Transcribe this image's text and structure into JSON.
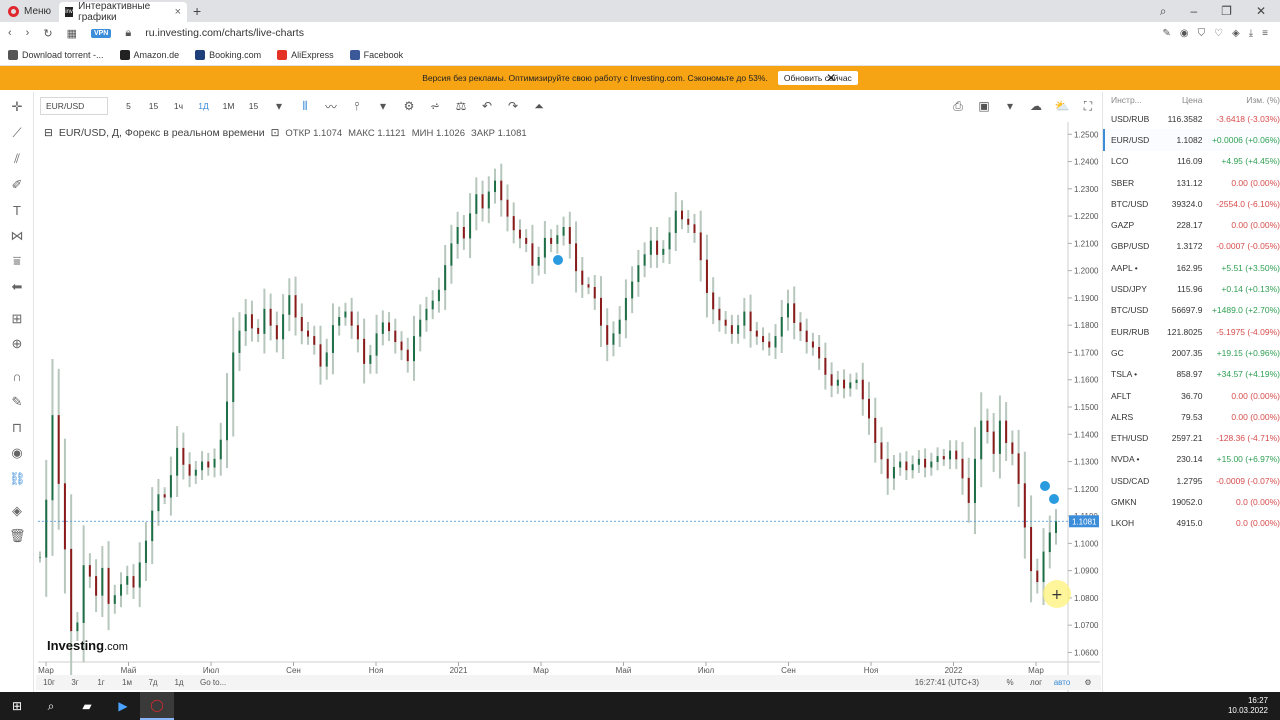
{
  "browser": {
    "menu_label": "Меню",
    "tab_title": "Интерактивные графики",
    "tab_favicon": "inv",
    "address": "ru.investing.com/charts/live-charts",
    "vpn_badge": "VPN",
    "bookmarks": [
      "Download torrent -...",
      "Amazon.de",
      "Booking.com",
      "AliExpress",
      "Facebook"
    ]
  },
  "promo": {
    "text": "Версия без рекламы. Оптимизируйте свою работу с Investing.com. Сэкономьте до 53%.",
    "button": "Обновить сейчас",
    "close": "✕"
  },
  "toolbar": {
    "symbol": "EUR/USD",
    "timeframes": [
      "5",
      "15",
      "1ч",
      "1Д",
      "1М",
      "15"
    ],
    "active_timeframe": "1Д"
  },
  "legend": {
    "title": "EUR/USD, Д, Форекс в реальном времени",
    "open": "ОТКР 1.1074",
    "high": "МАКС 1.1121",
    "low": "МИН 1.1026",
    "close": "ЗАКР 1.1081"
  },
  "logo": {
    "main": "Investing",
    "suffix": ".com"
  },
  "bottom": {
    "ranges": [
      "10г",
      "3г",
      "1г",
      "1м",
      "7д",
      "1д",
      "Go to..."
    ],
    "time": "16:27:41 (UTC+3)",
    "percent": "%",
    "log": "лог",
    "auto": "авто"
  },
  "chart_data": {
    "type": "line",
    "title": "EUR/USD, Д, Форекс в реальном времени",
    "x_tick_labels": [
      "Мар",
      "Май",
      "Июл",
      "Сен",
      "Ноя",
      "2021",
      "Мар",
      "Май",
      "Июл",
      "Сен",
      "Ноя",
      "2022",
      "Мар"
    ],
    "y_tick_labels": [
      "1.2500",
      "1.2400",
      "1.2300",
      "1.2200",
      "1.2100",
      "1.2000",
      "1.1900",
      "1.1800",
      "1.1700",
      "1.1600",
      "1.1500",
      "1.1400",
      "1.1300",
      "1.1200",
      "1.1100",
      "1.1000",
      "1.0900",
      "1.0800",
      "1.0700",
      "1.0600"
    ],
    "ylim": [
      1.0565,
      1.2545
    ],
    "last_price": "1.1081",
    "last_value": 1.1081,
    "series": [
      {
        "values": [
          1.095,
          1.116,
          1.147,
          1.122,
          1.098,
          1.068,
          1.071,
          1.092,
          1.088,
          1.081,
          1.091,
          1.078,
          1.081,
          1.085,
          1.088,
          1.084,
          1.093,
          1.101,
          1.112,
          1.118,
          1.117,
          1.125,
          1.135,
          1.129,
          1.125,
          1.127,
          1.13,
          1.128,
          1.131,
          1.138,
          1.152,
          1.17,
          1.178,
          1.184,
          1.179,
          1.177,
          1.186,
          1.18,
          1.175,
          1.184,
          1.191,
          1.183,
          1.178,
          1.176,
          1.173,
          1.165,
          1.17,
          1.18,
          1.183,
          1.185,
          1.18,
          1.175,
          1.166,
          1.169,
          1.177,
          1.181,
          1.178,
          1.174,
          1.171,
          1.167,
          1.176,
          1.182,
          1.186,
          1.189,
          1.193,
          1.202,
          1.21,
          1.216,
          1.212,
          1.221,
          1.228,
          1.223,
          1.229,
          1.233,
          1.226,
          1.22,
          1.215,
          1.212,
          1.21,
          1.202,
          1.205,
          1.212,
          1.21,
          1.213,
          1.216,
          1.21,
          1.2,
          1.195,
          1.194,
          1.19,
          1.18,
          1.173,
          1.177,
          1.182,
          1.19,
          1.196,
          1.202,
          1.206,
          1.211,
          1.206,
          1.208,
          1.214,
          1.222,
          1.219,
          1.217,
          1.214,
          1.204,
          1.192,
          1.186,
          1.182,
          1.18,
          1.177,
          1.18,
          1.185,
          1.178,
          1.176,
          1.174,
          1.172,
          1.176,
          1.183,
          1.188,
          1.181,
          1.178,
          1.174,
          1.172,
          1.168,
          1.162,
          1.158,
          1.16,
          1.157,
          1.159,
          1.16,
          1.153,
          1.146,
          1.137,
          1.131,
          1.124,
          1.128,
          1.13,
          1.127,
          1.129,
          1.131,
          1.128,
          1.13,
          1.132,
          1.131,
          1.134,
          1.131,
          1.124,
          1.115,
          1.131,
          1.145,
          1.141,
          1.133,
          1.145,
          1.137,
          1.133,
          1.122,
          1.106,
          1.09,
          1.086,
          1.097,
          1.104,
          1.1081
        ]
      }
    ]
  },
  "watchlist": {
    "headers": [
      "Инстр...",
      "Цена",
      "Изм. (%)"
    ],
    "rows": [
      {
        "name": "USD/RUB",
        "price": "116.3582",
        "change": "-3.6418 (-3.03%)",
        "dir": "dn"
      },
      {
        "name": "EUR/USD",
        "price": "1.1082",
        "change": "+0.0006 (+0.06%)",
        "dir": "up"
      },
      {
        "name": "LCO",
        "price": "116.09",
        "change": "+4.95 (+4.45%)",
        "dir": "up"
      },
      {
        "name": "SBER",
        "price": "131.12",
        "change": "0.00 (0.00%)",
        "dir": "dn"
      },
      {
        "name": "BTC/USD",
        "price": "39324.0",
        "change": "-2554.0 (-6.10%)",
        "dir": "dn"
      },
      {
        "name": "GAZP",
        "price": "228.17",
        "change": "0.00 (0.00%)",
        "dir": "dn"
      },
      {
        "name": "GBP/USD",
        "price": "1.3172",
        "change": "-0.0007 (-0.05%)",
        "dir": "dn"
      },
      {
        "name": "AAPL •",
        "price": "162.95",
        "change": "+5.51 (+3.50%)",
        "dir": "up"
      },
      {
        "name": "USD/JPY",
        "price": "115.96",
        "change": "+0.14 (+0.13%)",
        "dir": "up"
      },
      {
        "name": "BTC/USD",
        "price": "56697.9",
        "change": "+1489.0 (+2.70%)",
        "dir": "up"
      },
      {
        "name": "EUR/RUB",
        "price": "121.8025",
        "change": "-5.1975 (-4.09%)",
        "dir": "dn"
      },
      {
        "name": "GC",
        "price": "2007.35",
        "change": "+19.15 (+0.96%)",
        "dir": "up"
      },
      {
        "name": "TSLA •",
        "price": "858.97",
        "change": "+34.57 (+4.19%)",
        "dir": "up"
      },
      {
        "name": "AFLT",
        "price": "36.70",
        "change": "0.00 (0.00%)",
        "dir": "dn"
      },
      {
        "name": "ALRS",
        "price": "79.53",
        "change": "0.00 (0.00%)",
        "dir": "dn"
      },
      {
        "name": "ETH/USD",
        "price": "2597.21",
        "change": "-128.36 (-4.71%)",
        "dir": "dn"
      },
      {
        "name": "NVDA •",
        "price": "230.14",
        "change": "+15.00 (+6.97%)",
        "dir": "up"
      },
      {
        "name": "USD/CAD",
        "price": "1.2795",
        "change": "-0.0009 (-0.07%)",
        "dir": "dn"
      },
      {
        "name": "GMKN",
        "price": "19052.0",
        "change": "0.0 (0.00%)",
        "dir": "dn"
      },
      {
        "name": "LKOH",
        "price": "4915.0",
        "change": "0.0 (0.00%)",
        "dir": "dn"
      }
    ]
  },
  "taskbar": {
    "time": "16:27",
    "date": "10.03.2022"
  },
  "colors": {
    "up": "#2e9f52",
    "down": "#d64c4c",
    "accent": "#3c8dd9",
    "promo": "#f7a414"
  }
}
